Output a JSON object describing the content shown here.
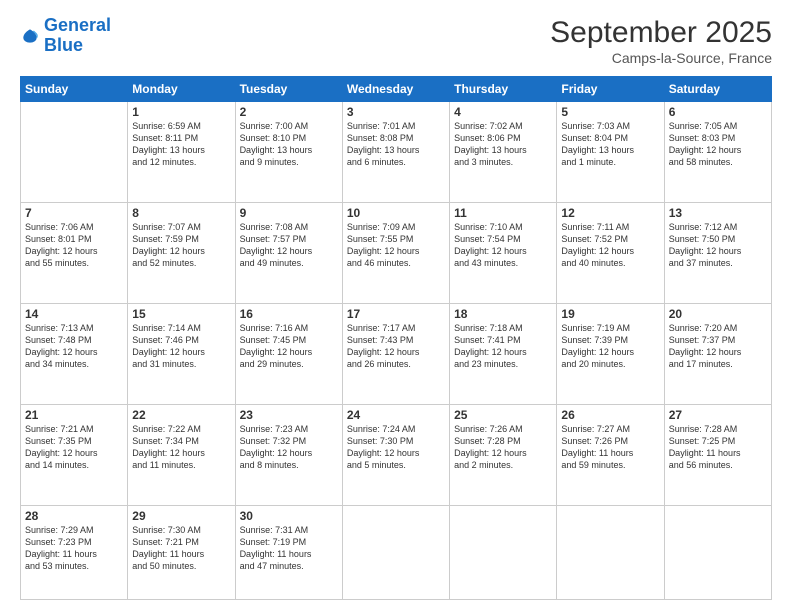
{
  "header": {
    "logo_line1": "General",
    "logo_line2": "Blue",
    "month": "September 2025",
    "location": "Camps-la-Source, France"
  },
  "weekdays": [
    "Sunday",
    "Monday",
    "Tuesday",
    "Wednesday",
    "Thursday",
    "Friday",
    "Saturday"
  ],
  "weeks": [
    [
      {
        "day": "",
        "text": ""
      },
      {
        "day": "1",
        "text": "Sunrise: 6:59 AM\nSunset: 8:11 PM\nDaylight: 13 hours\nand 12 minutes."
      },
      {
        "day": "2",
        "text": "Sunrise: 7:00 AM\nSunset: 8:10 PM\nDaylight: 13 hours\nand 9 minutes."
      },
      {
        "day": "3",
        "text": "Sunrise: 7:01 AM\nSunset: 8:08 PM\nDaylight: 13 hours\nand 6 minutes."
      },
      {
        "day": "4",
        "text": "Sunrise: 7:02 AM\nSunset: 8:06 PM\nDaylight: 13 hours\nand 3 minutes."
      },
      {
        "day": "5",
        "text": "Sunrise: 7:03 AM\nSunset: 8:04 PM\nDaylight: 13 hours\nand 1 minute."
      },
      {
        "day": "6",
        "text": "Sunrise: 7:05 AM\nSunset: 8:03 PM\nDaylight: 12 hours\nand 58 minutes."
      }
    ],
    [
      {
        "day": "7",
        "text": "Sunrise: 7:06 AM\nSunset: 8:01 PM\nDaylight: 12 hours\nand 55 minutes."
      },
      {
        "day": "8",
        "text": "Sunrise: 7:07 AM\nSunset: 7:59 PM\nDaylight: 12 hours\nand 52 minutes."
      },
      {
        "day": "9",
        "text": "Sunrise: 7:08 AM\nSunset: 7:57 PM\nDaylight: 12 hours\nand 49 minutes."
      },
      {
        "day": "10",
        "text": "Sunrise: 7:09 AM\nSunset: 7:55 PM\nDaylight: 12 hours\nand 46 minutes."
      },
      {
        "day": "11",
        "text": "Sunrise: 7:10 AM\nSunset: 7:54 PM\nDaylight: 12 hours\nand 43 minutes."
      },
      {
        "day": "12",
        "text": "Sunrise: 7:11 AM\nSunset: 7:52 PM\nDaylight: 12 hours\nand 40 minutes."
      },
      {
        "day": "13",
        "text": "Sunrise: 7:12 AM\nSunset: 7:50 PM\nDaylight: 12 hours\nand 37 minutes."
      }
    ],
    [
      {
        "day": "14",
        "text": "Sunrise: 7:13 AM\nSunset: 7:48 PM\nDaylight: 12 hours\nand 34 minutes."
      },
      {
        "day": "15",
        "text": "Sunrise: 7:14 AM\nSunset: 7:46 PM\nDaylight: 12 hours\nand 31 minutes."
      },
      {
        "day": "16",
        "text": "Sunrise: 7:16 AM\nSunset: 7:45 PM\nDaylight: 12 hours\nand 29 minutes."
      },
      {
        "day": "17",
        "text": "Sunrise: 7:17 AM\nSunset: 7:43 PM\nDaylight: 12 hours\nand 26 minutes."
      },
      {
        "day": "18",
        "text": "Sunrise: 7:18 AM\nSunset: 7:41 PM\nDaylight: 12 hours\nand 23 minutes."
      },
      {
        "day": "19",
        "text": "Sunrise: 7:19 AM\nSunset: 7:39 PM\nDaylight: 12 hours\nand 20 minutes."
      },
      {
        "day": "20",
        "text": "Sunrise: 7:20 AM\nSunset: 7:37 PM\nDaylight: 12 hours\nand 17 minutes."
      }
    ],
    [
      {
        "day": "21",
        "text": "Sunrise: 7:21 AM\nSunset: 7:35 PM\nDaylight: 12 hours\nand 14 minutes."
      },
      {
        "day": "22",
        "text": "Sunrise: 7:22 AM\nSunset: 7:34 PM\nDaylight: 12 hours\nand 11 minutes."
      },
      {
        "day": "23",
        "text": "Sunrise: 7:23 AM\nSunset: 7:32 PM\nDaylight: 12 hours\nand 8 minutes."
      },
      {
        "day": "24",
        "text": "Sunrise: 7:24 AM\nSunset: 7:30 PM\nDaylight: 12 hours\nand 5 minutes."
      },
      {
        "day": "25",
        "text": "Sunrise: 7:26 AM\nSunset: 7:28 PM\nDaylight: 12 hours\nand 2 minutes."
      },
      {
        "day": "26",
        "text": "Sunrise: 7:27 AM\nSunset: 7:26 PM\nDaylight: 11 hours\nand 59 minutes."
      },
      {
        "day": "27",
        "text": "Sunrise: 7:28 AM\nSunset: 7:25 PM\nDaylight: 11 hours\nand 56 minutes."
      }
    ],
    [
      {
        "day": "28",
        "text": "Sunrise: 7:29 AM\nSunset: 7:23 PM\nDaylight: 11 hours\nand 53 minutes."
      },
      {
        "day": "29",
        "text": "Sunrise: 7:30 AM\nSunset: 7:21 PM\nDaylight: 11 hours\nand 50 minutes."
      },
      {
        "day": "30",
        "text": "Sunrise: 7:31 AM\nSunset: 7:19 PM\nDaylight: 11 hours\nand 47 minutes."
      },
      {
        "day": "",
        "text": ""
      },
      {
        "day": "",
        "text": ""
      },
      {
        "day": "",
        "text": ""
      },
      {
        "day": "",
        "text": ""
      }
    ]
  ]
}
